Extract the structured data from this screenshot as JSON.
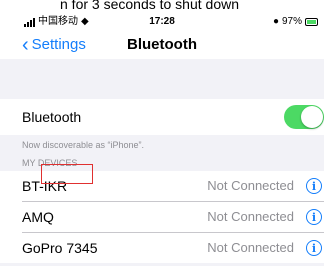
{
  "caption": "n for 3 seconds to shut down",
  "status_bar": {
    "carrier": "中国移动",
    "time": "17:28",
    "battery": "97%"
  },
  "nav": {
    "back_label": "Settings",
    "title": "Bluetooth"
  },
  "bluetooth": {
    "label": "Bluetooth",
    "enabled": true
  },
  "discoverable_note": "Now discoverable as “iPhone”.",
  "section_header": "MY DEVICES",
  "devices": [
    {
      "name": "BT-IKR",
      "status": "Not Connected"
    },
    {
      "name": "AMQ",
      "status": "Not Connected"
    },
    {
      "name": "GoPro 7345",
      "status": "Not Connected"
    }
  ],
  "colors": {
    "accent": "#147efb",
    "toggle_on": "#4cd964",
    "highlight_box": "#e03030"
  }
}
